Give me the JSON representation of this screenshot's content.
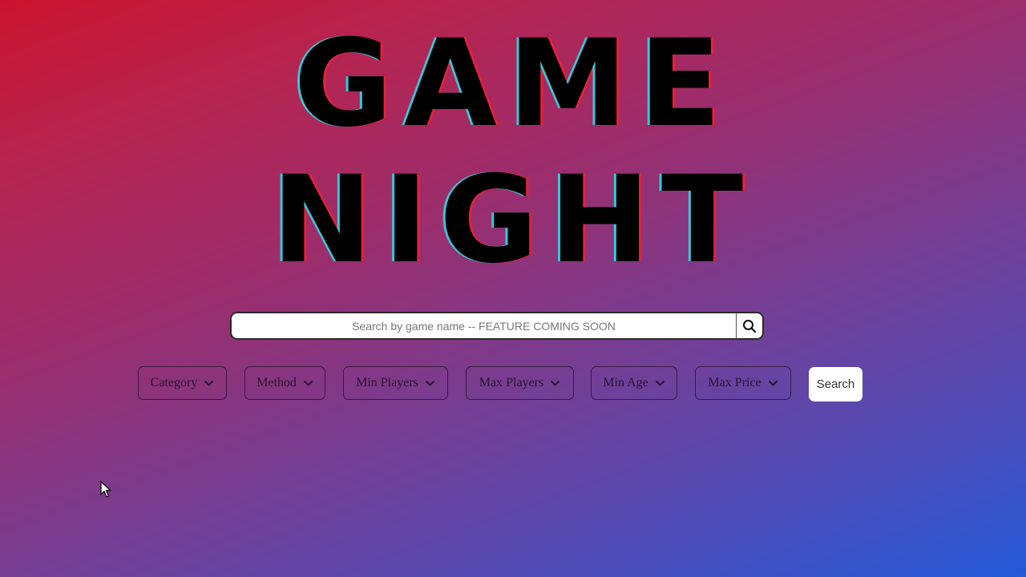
{
  "title": {
    "line1": "GAME",
    "line2": "NIGHT"
  },
  "search": {
    "placeholder": "Search by game name -- FEATURE COMING SOON",
    "button_icon": "search-icon"
  },
  "filters": [
    {
      "label": "Category",
      "icon": "chevron-down-icon"
    },
    {
      "label": "Method",
      "icon": "chevron-down-icon"
    },
    {
      "label": "Min Players",
      "icon": "chevron-down-icon"
    },
    {
      "label": "Max Players",
      "icon": "chevron-down-icon"
    },
    {
      "label": "Min Age",
      "icon": "chevron-down-icon"
    },
    {
      "label": "Max Price",
      "icon": "chevron-down-icon"
    }
  ],
  "search_button": {
    "label": "Search"
  },
  "colors": {
    "gradient_start": "#cc1430",
    "gradient_end": "#2459d8",
    "title_fill": "#000000",
    "title_shadow_cyan": "#35c8d8",
    "title_shadow_red": "#e8203a"
  }
}
